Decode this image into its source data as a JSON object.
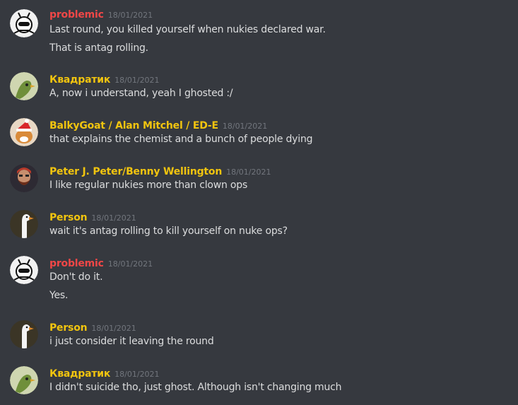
{
  "colors": {
    "background": "#36393f",
    "text": "#dcddde",
    "timestamp": "#72767d",
    "name_red": "#f04747",
    "name_gold": "#f1c40f"
  },
  "messages": [
    {
      "author": "problemic",
      "timestamp": "18/01/2021",
      "avatar": "robot-avatar-icon",
      "lines": [
        "Last round, you killed yourself when nukies declared war.",
        "That is antag rolling."
      ]
    },
    {
      "author": "Квадратик",
      "timestamp": "18/01/2021",
      "avatar": "green-bird-avatar-icon",
      "lines": [
        "A, now i understand, yeah I ghosted :/"
      ]
    },
    {
      "author": "BalkyGoat / Alan Mitchel / ED-E",
      "timestamp": "18/01/2021",
      "avatar": "goat-santa-avatar-icon",
      "lines": [
        "that explains the chemist and a bunch of people dying"
      ]
    },
    {
      "author": "Peter J. Peter/Benny Wellington",
      "timestamp": "18/01/2021",
      "avatar": "bearded-man-avatar-icon",
      "lines": [
        "I like regular nukies more than clown ops"
      ]
    },
    {
      "author": "Person",
      "timestamp": "18/01/2021",
      "avatar": "goose-avatar-icon",
      "lines": [
        "wait it's antag rolling to kill yourself on nuke ops?"
      ]
    },
    {
      "author": "problemic",
      "timestamp": "18/01/2021",
      "avatar": "robot-avatar-icon",
      "lines": [
        "Don't do it.",
        "Yes."
      ]
    },
    {
      "author": "Person",
      "timestamp": "18/01/2021",
      "avatar": "goose-avatar-icon",
      "lines": [
        "i just consider it leaving the round"
      ]
    },
    {
      "author": "Квадратик",
      "timestamp": "18/01/2021",
      "avatar": "green-bird-avatar-icon",
      "lines": [
        "I didn't suicide tho, just ghost. Although isn't changing much"
      ]
    }
  ]
}
